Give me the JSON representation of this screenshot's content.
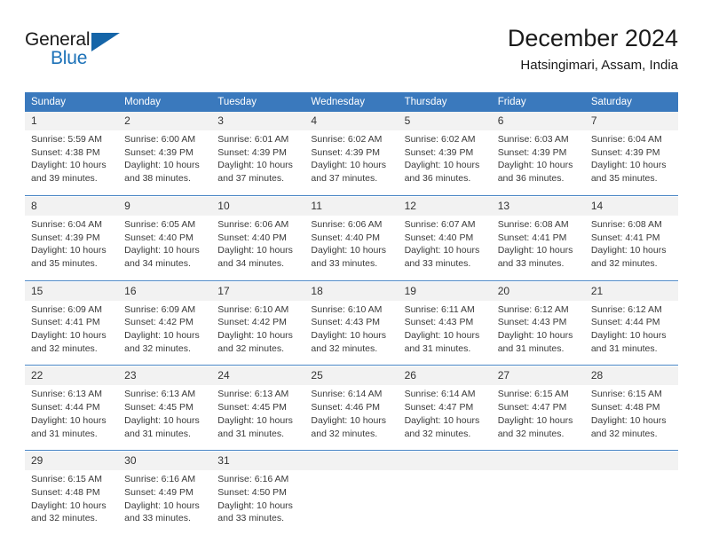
{
  "brand": {
    "word_one": "General",
    "word_two": "Blue",
    "flag_icon": "triangle-flag-icon"
  },
  "header": {
    "title": "December 2024",
    "location": "Hatsingimari, Assam, India"
  },
  "colors": {
    "header_blue": "#3a79bd",
    "separator_blue": "#4a86c5",
    "daynum_background": "#f2f2f2",
    "brand_blue": "#1d72b8",
    "flag_blue": "#1565a8",
    "text": "#3a3a3a"
  },
  "calendar": {
    "weekday_headers": [
      "Sunday",
      "Monday",
      "Tuesday",
      "Wednesday",
      "Thursday",
      "Friday",
      "Saturday"
    ],
    "weeks": [
      [
        {
          "day": "1",
          "sunrise": "Sunrise: 5:59 AM",
          "sunset": "Sunset: 4:38 PM",
          "daylight_1": "Daylight: 10 hours",
          "daylight_2": "and 39 minutes."
        },
        {
          "day": "2",
          "sunrise": "Sunrise: 6:00 AM",
          "sunset": "Sunset: 4:39 PM",
          "daylight_1": "Daylight: 10 hours",
          "daylight_2": "and 38 minutes."
        },
        {
          "day": "3",
          "sunrise": "Sunrise: 6:01 AM",
          "sunset": "Sunset: 4:39 PM",
          "daylight_1": "Daylight: 10 hours",
          "daylight_2": "and 37 minutes."
        },
        {
          "day": "4",
          "sunrise": "Sunrise: 6:02 AM",
          "sunset": "Sunset: 4:39 PM",
          "daylight_1": "Daylight: 10 hours",
          "daylight_2": "and 37 minutes."
        },
        {
          "day": "5",
          "sunrise": "Sunrise: 6:02 AM",
          "sunset": "Sunset: 4:39 PM",
          "daylight_1": "Daylight: 10 hours",
          "daylight_2": "and 36 minutes."
        },
        {
          "day": "6",
          "sunrise": "Sunrise: 6:03 AM",
          "sunset": "Sunset: 4:39 PM",
          "daylight_1": "Daylight: 10 hours",
          "daylight_2": "and 36 minutes."
        },
        {
          "day": "7",
          "sunrise": "Sunrise: 6:04 AM",
          "sunset": "Sunset: 4:39 PM",
          "daylight_1": "Daylight: 10 hours",
          "daylight_2": "and 35 minutes."
        }
      ],
      [
        {
          "day": "8",
          "sunrise": "Sunrise: 6:04 AM",
          "sunset": "Sunset: 4:39 PM",
          "daylight_1": "Daylight: 10 hours",
          "daylight_2": "and 35 minutes."
        },
        {
          "day": "9",
          "sunrise": "Sunrise: 6:05 AM",
          "sunset": "Sunset: 4:40 PM",
          "daylight_1": "Daylight: 10 hours",
          "daylight_2": "and 34 minutes."
        },
        {
          "day": "10",
          "sunrise": "Sunrise: 6:06 AM",
          "sunset": "Sunset: 4:40 PM",
          "daylight_1": "Daylight: 10 hours",
          "daylight_2": "and 34 minutes."
        },
        {
          "day": "11",
          "sunrise": "Sunrise: 6:06 AM",
          "sunset": "Sunset: 4:40 PM",
          "daylight_1": "Daylight: 10 hours",
          "daylight_2": "and 33 minutes."
        },
        {
          "day": "12",
          "sunrise": "Sunrise: 6:07 AM",
          "sunset": "Sunset: 4:40 PM",
          "daylight_1": "Daylight: 10 hours",
          "daylight_2": "and 33 minutes."
        },
        {
          "day": "13",
          "sunrise": "Sunrise: 6:08 AM",
          "sunset": "Sunset: 4:41 PM",
          "daylight_1": "Daylight: 10 hours",
          "daylight_2": "and 33 minutes."
        },
        {
          "day": "14",
          "sunrise": "Sunrise: 6:08 AM",
          "sunset": "Sunset: 4:41 PM",
          "daylight_1": "Daylight: 10 hours",
          "daylight_2": "and 32 minutes."
        }
      ],
      [
        {
          "day": "15",
          "sunrise": "Sunrise: 6:09 AM",
          "sunset": "Sunset: 4:41 PM",
          "daylight_1": "Daylight: 10 hours",
          "daylight_2": "and 32 minutes."
        },
        {
          "day": "16",
          "sunrise": "Sunrise: 6:09 AM",
          "sunset": "Sunset: 4:42 PM",
          "daylight_1": "Daylight: 10 hours",
          "daylight_2": "and 32 minutes."
        },
        {
          "day": "17",
          "sunrise": "Sunrise: 6:10 AM",
          "sunset": "Sunset: 4:42 PM",
          "daylight_1": "Daylight: 10 hours",
          "daylight_2": "and 32 minutes."
        },
        {
          "day": "18",
          "sunrise": "Sunrise: 6:10 AM",
          "sunset": "Sunset: 4:43 PM",
          "daylight_1": "Daylight: 10 hours",
          "daylight_2": "and 32 minutes."
        },
        {
          "day": "19",
          "sunrise": "Sunrise: 6:11 AM",
          "sunset": "Sunset: 4:43 PM",
          "daylight_1": "Daylight: 10 hours",
          "daylight_2": "and 31 minutes."
        },
        {
          "day": "20",
          "sunrise": "Sunrise: 6:12 AM",
          "sunset": "Sunset: 4:43 PM",
          "daylight_1": "Daylight: 10 hours",
          "daylight_2": "and 31 minutes."
        },
        {
          "day": "21",
          "sunrise": "Sunrise: 6:12 AM",
          "sunset": "Sunset: 4:44 PM",
          "daylight_1": "Daylight: 10 hours",
          "daylight_2": "and 31 minutes."
        }
      ],
      [
        {
          "day": "22",
          "sunrise": "Sunrise: 6:13 AM",
          "sunset": "Sunset: 4:44 PM",
          "daylight_1": "Daylight: 10 hours",
          "daylight_2": "and 31 minutes."
        },
        {
          "day": "23",
          "sunrise": "Sunrise: 6:13 AM",
          "sunset": "Sunset: 4:45 PM",
          "daylight_1": "Daylight: 10 hours",
          "daylight_2": "and 31 minutes."
        },
        {
          "day": "24",
          "sunrise": "Sunrise: 6:13 AM",
          "sunset": "Sunset: 4:45 PM",
          "daylight_1": "Daylight: 10 hours",
          "daylight_2": "and 31 minutes."
        },
        {
          "day": "25",
          "sunrise": "Sunrise: 6:14 AM",
          "sunset": "Sunset: 4:46 PM",
          "daylight_1": "Daylight: 10 hours",
          "daylight_2": "and 32 minutes."
        },
        {
          "day": "26",
          "sunrise": "Sunrise: 6:14 AM",
          "sunset": "Sunset: 4:47 PM",
          "daylight_1": "Daylight: 10 hours",
          "daylight_2": "and 32 minutes."
        },
        {
          "day": "27",
          "sunrise": "Sunrise: 6:15 AM",
          "sunset": "Sunset: 4:47 PM",
          "daylight_1": "Daylight: 10 hours",
          "daylight_2": "and 32 minutes."
        },
        {
          "day": "28",
          "sunrise": "Sunrise: 6:15 AM",
          "sunset": "Sunset: 4:48 PM",
          "daylight_1": "Daylight: 10 hours",
          "daylight_2": "and 32 minutes."
        }
      ],
      [
        {
          "day": "29",
          "sunrise": "Sunrise: 6:15 AM",
          "sunset": "Sunset: 4:48 PM",
          "daylight_1": "Daylight: 10 hours",
          "daylight_2": "and 32 minutes."
        },
        {
          "day": "30",
          "sunrise": "Sunrise: 6:16 AM",
          "sunset": "Sunset: 4:49 PM",
          "daylight_1": "Daylight: 10 hours",
          "daylight_2": "and 33 minutes."
        },
        {
          "day": "31",
          "sunrise": "Sunrise: 6:16 AM",
          "sunset": "Sunset: 4:50 PM",
          "daylight_1": "Daylight: 10 hours",
          "daylight_2": "and 33 minutes."
        },
        {
          "day": "",
          "sunrise": "",
          "sunset": "",
          "daylight_1": "",
          "daylight_2": ""
        },
        {
          "day": "",
          "sunrise": "",
          "sunset": "",
          "daylight_1": "",
          "daylight_2": ""
        },
        {
          "day": "",
          "sunrise": "",
          "sunset": "",
          "daylight_1": "",
          "daylight_2": ""
        },
        {
          "day": "",
          "sunrise": "",
          "sunset": "",
          "daylight_1": "",
          "daylight_2": ""
        }
      ]
    ]
  }
}
